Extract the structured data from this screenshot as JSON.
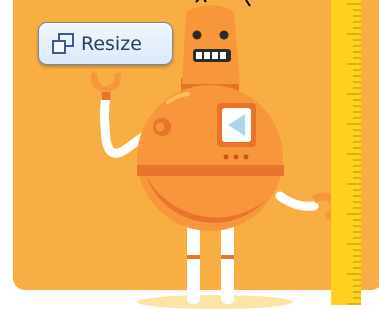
{
  "toolbar": {
    "resize_label": "Resize",
    "resize_icon": "resize-icon"
  },
  "colors": {
    "card_background": "#f9ae43",
    "robot_body": "#f7963a",
    "robot_shade": "#e8732b",
    "ruler": "#ffd21f",
    "button_background": "#e6effc",
    "button_text": "#2a3d5a"
  }
}
